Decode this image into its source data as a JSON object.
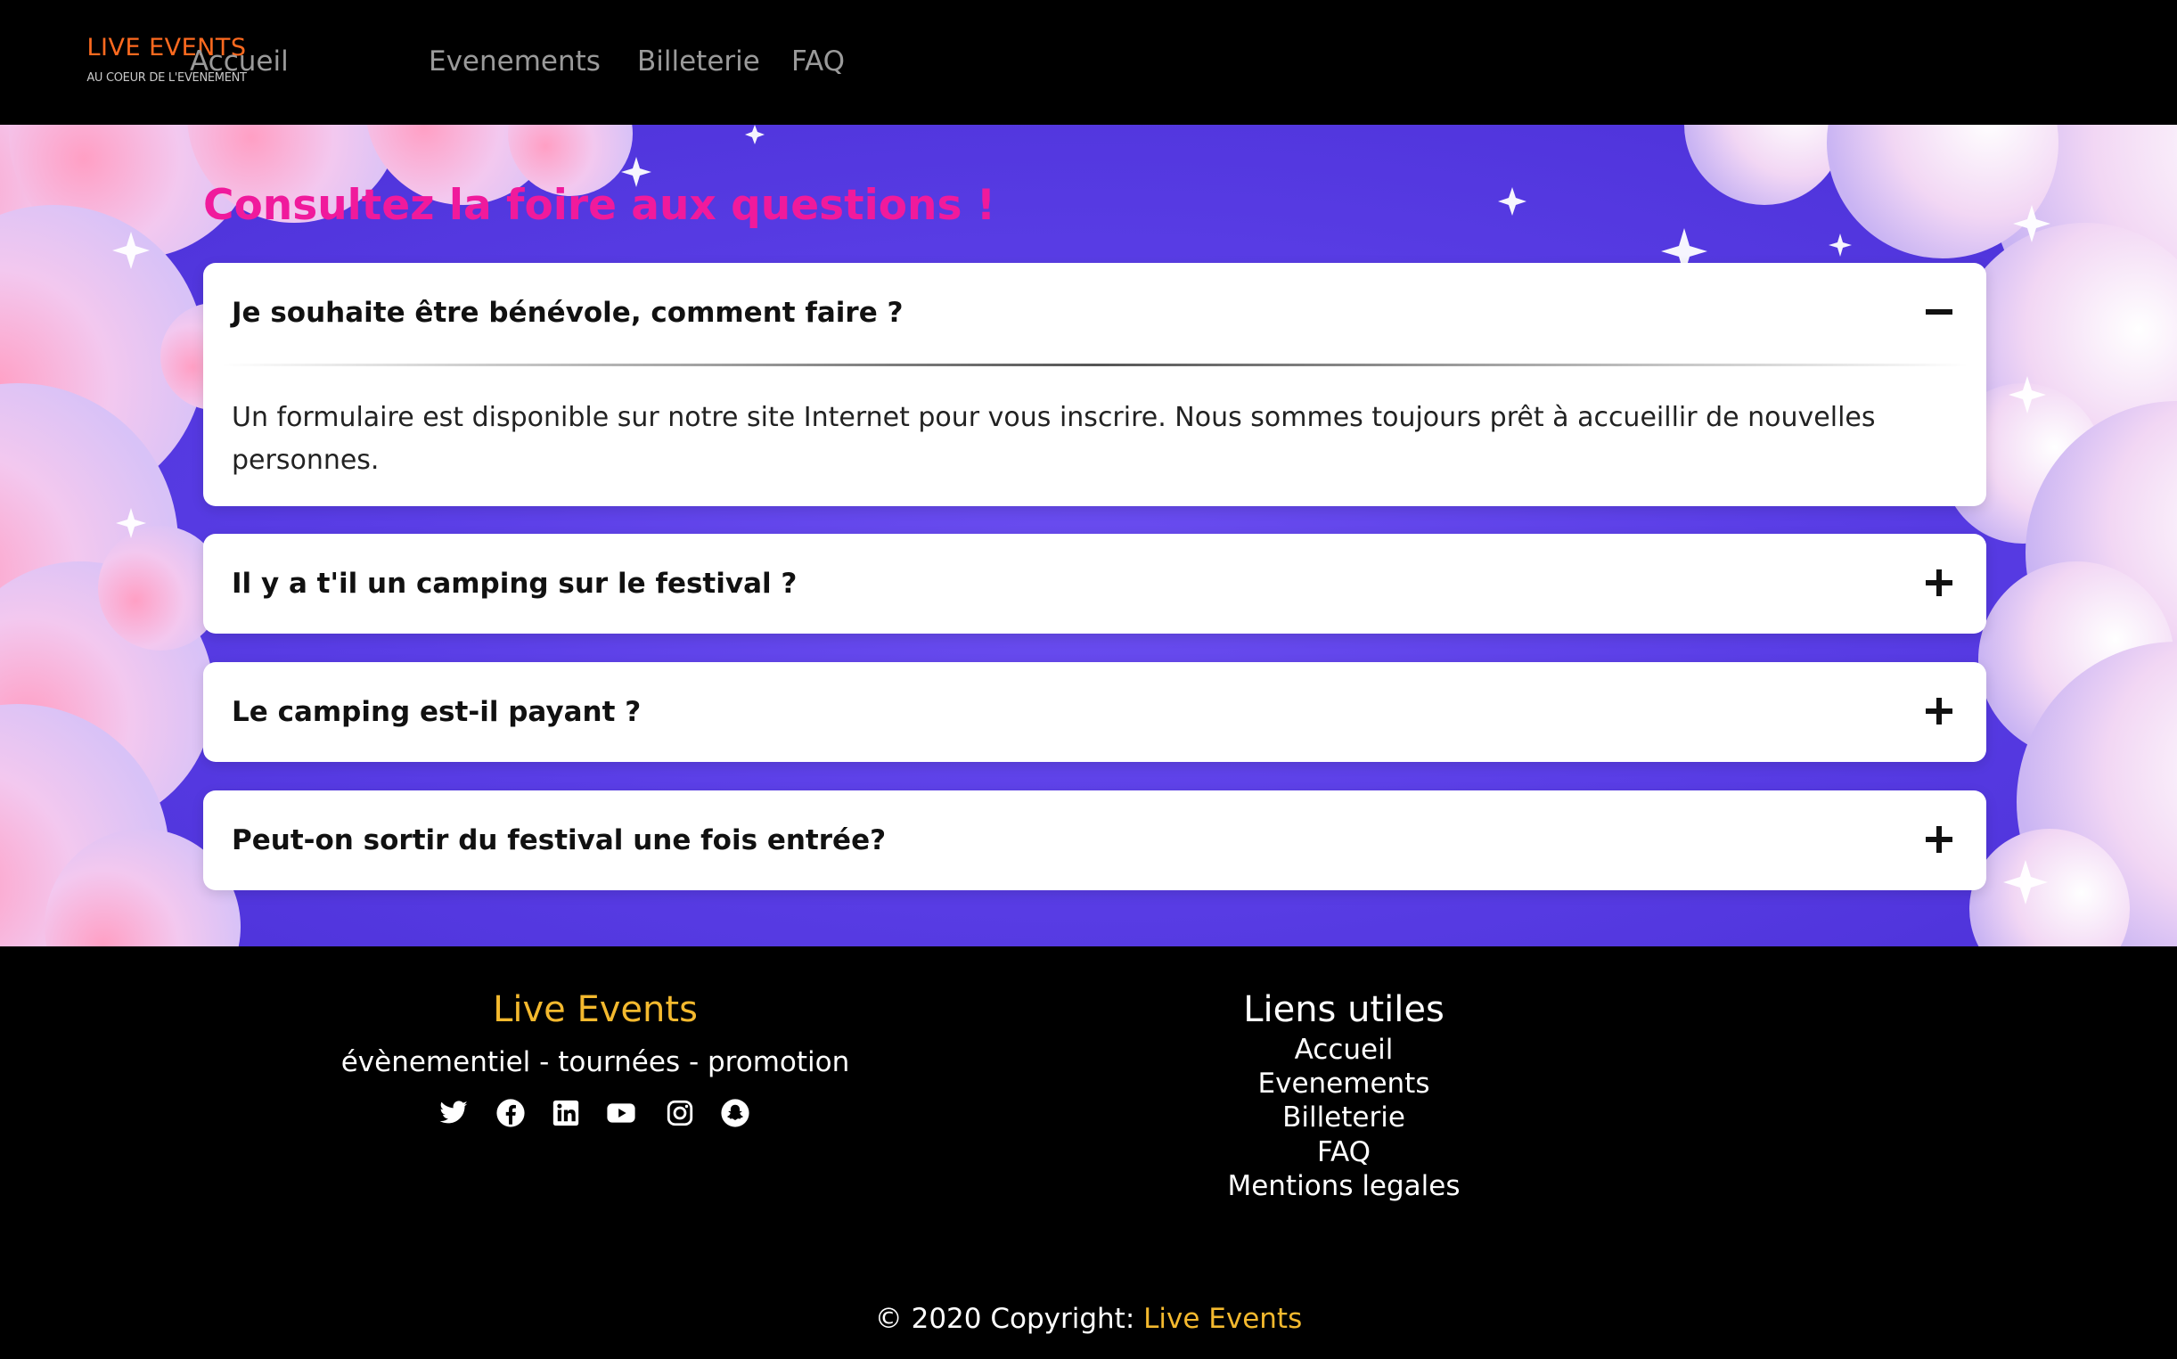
{
  "navbar": {
    "brand_title": "LIVE EVENTS",
    "brand_subtitle": "AU COEUR DE L'EVENEMENT",
    "links": [
      "Accueil",
      "Evenements",
      "Billeterie",
      "FAQ"
    ]
  },
  "faq": {
    "title": "Consultez la foire aux questions !",
    "items": [
      {
        "question": "Je souhaite être bénévole, comment faire ?",
        "expanded": true,
        "toggle_icon": "minus-icon",
        "answer": "Un formulaire est disponible sur notre site Internet pour vous inscrire. Nous sommes toujours prêt à accueillir de nouvelles personnes."
      },
      {
        "question": "Il y a t'il un camping sur le festival ?",
        "expanded": false,
        "toggle_icon": "plus-icon"
      },
      {
        "question": "Le camping est-il payant ?",
        "expanded": false,
        "toggle_icon": "plus-icon"
      },
      {
        "question": "Peut-on sortir du festival une fois entrée?",
        "expanded": false,
        "toggle_icon": "plus-icon"
      }
    ]
  },
  "footer": {
    "brand": "Live Events",
    "tagline": "évènementiel - tournées - promotion",
    "socials": [
      "twitter-icon",
      "facebook-icon",
      "linkedin-icon",
      "youtube-icon",
      "instagram-icon",
      "snapchat-icon"
    ],
    "links_title": "Liens utiles",
    "links": [
      "Accueil",
      "Evenements",
      "Billeterie",
      "FAQ",
      "Mentions legales"
    ],
    "copyright_prefix": "© 2020 Copyright: ",
    "copyright_brand": "Live Events"
  },
  "colors": {
    "brand_orange": "#ff6a1f",
    "title_pink": "#f01a9c",
    "accent_gold": "#f4b92e",
    "hero_purple": "#5a3ee6"
  }
}
